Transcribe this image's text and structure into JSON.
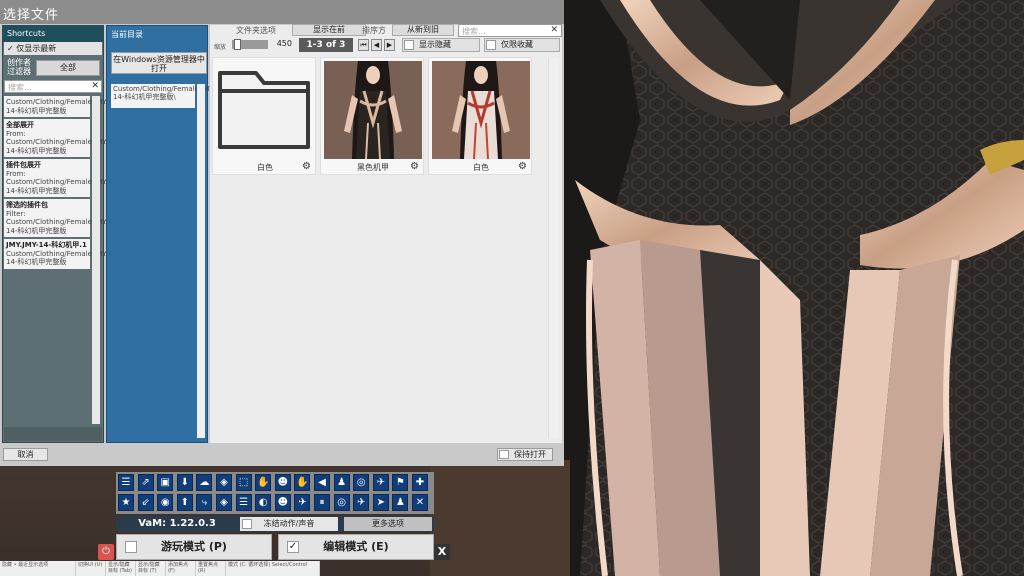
{
  "dialog": {
    "title": "选择文件",
    "shortcuts": {
      "header": "Shortcuts",
      "show_latest_label": "仅显示最新",
      "creator_filter_label": "创作者过滤器",
      "creator_filter_value": "全部",
      "search_placeholder": "搜索...",
      "items": [
        {
          "title": "",
          "text": "Custom/Clothing/Female/JMY/JMY-14-科幻机甲完整版"
        },
        {
          "title": "全部展开",
          "text": "From: Custom/Clothing/Female/JMY/JMY-14-科幻机甲完整版"
        },
        {
          "title": "插件包展开",
          "text": "From: Custom/Clothing/Female/JMY/JMY-14-科幻机甲完整版"
        },
        {
          "title": "筛选的插件包",
          "text": "Filter: Custom/Clothing/Female/JMY/JMY-14-科幻机甲完整版"
        },
        {
          "title": "JMY.JMY-14-科幻机甲.1",
          "text": "Custom/Clothing/Female/JMY/JMY-14-科幻机甲完整版"
        }
      ]
    },
    "current_dir": {
      "header": "当前目录",
      "open_explorer_label": "在Windows资源管理器中打开",
      "path": "Custom/Clothing/Female/JMY/JMY-14-科幻机甲完整版\\"
    },
    "browser": {
      "folder_options_label": "文件夹选项",
      "show_first_label": "显示在前",
      "sort_label": "排序方",
      "sort_value": "从新到旧",
      "search_placeholder": "搜索...",
      "zoom_label": "缩放",
      "zoom_value": "450",
      "page_indicator": "1-3 of 3",
      "nav_first": "⏮",
      "nav_prev": "◀",
      "nav_next": "▶",
      "show_hidden_label": "显示隐藏",
      "favorites_only_label": "仅限收藏",
      "tiles": [
        {
          "name": "白色",
          "kind": "folder"
        },
        {
          "name": "黑色机甲",
          "kind": "image"
        },
        {
          "name": "白色",
          "kind": "image"
        }
      ]
    },
    "cancel_label": "取消",
    "keep_open_label": "保持打开"
  },
  "menu": {
    "version": "VaM: 1.22.0.3",
    "freeze_label": "冻结动作/声音",
    "more_options_label": "更多选项",
    "play_mode_label": "游玩模式 (P)",
    "edit_mode_label": "编辑模式 (E)",
    "edit_mode_checked": "✓",
    "close_label": "X",
    "power_icon": "⏻",
    "icons_row1": [
      "☰",
      "⇗",
      "▣",
      "⬇",
      "☁",
      "◈",
      "⬚",
      "✋",
      "☻",
      "✋",
      "◀",
      "♟",
      "◎",
      "✈",
      "⚑",
      "✚"
    ],
    "icons_row2": [
      "★",
      "⇙",
      "◉",
      "⬆",
      "⤷",
      "◈",
      "☰",
      "◐",
      "☻",
      "✈",
      "⏸",
      "◎",
      "✈",
      "➤",
      "♟",
      "✕"
    ]
  },
  "statusbar": {
    "cells": [
      "隐藏 • 最近显示选项",
      "切换UI (U)",
      "显示/隐藏目标 (Tab)",
      "显示/隐藏目标 (T)",
      "添加焦点 (F)",
      "重置焦点 (R)",
      "模式 (C: 循环选择) Select/Control"
    ]
  },
  "colors": {
    "shortcuts_header": "#1f4f5c",
    "current_dir_panel": "#2f6fa2",
    "icon_button": "#113e7a",
    "version_bar": "#2c3b4c",
    "power_button": "#d9534f"
  }
}
